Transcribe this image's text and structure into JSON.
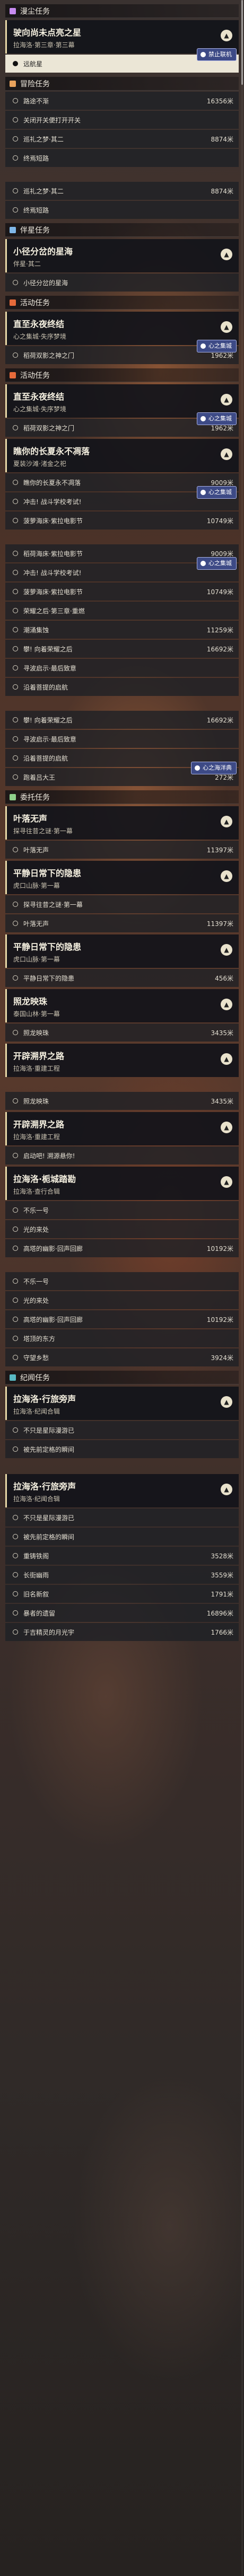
{
  "colors": {
    "spiral": "#c68bf0",
    "legend": "#e8a25c",
    "companion": "#7fb7e8",
    "event": "#e56a3a",
    "area": "#8ed08b",
    "leisure": "#58b9c4"
  },
  "items": [
    {
      "kind": "cat",
      "label": "漫尘任务",
      "color": "spiral"
    },
    {
      "kind": "card",
      "title": "驶向尚未点亮之星",
      "subtitle": "拉海洛·第三章·第三幕"
    },
    {
      "kind": "btn",
      "label": "远航星",
      "badge": "禁止联机"
    },
    {
      "kind": "cat",
      "label": "冒险任务",
      "color": "legend"
    },
    {
      "kind": "row",
      "label": "路途不渐",
      "value": "16356米"
    },
    {
      "kind": "row",
      "label": "关闭开关便打开开关",
      "value": ""
    },
    {
      "kind": "row",
      "label": "巡礼之梦·其二",
      "value": "8874米"
    },
    {
      "kind": "row",
      "label": "终焉短路",
      "value": ""
    },
    {
      "kind": "gap"
    },
    {
      "kind": "row",
      "label": "巡礼之梦·其二",
      "value": "8874米"
    },
    {
      "kind": "row",
      "label": "终焉短路",
      "value": ""
    },
    {
      "kind": "cat",
      "label": "伴星任务",
      "color": "companion"
    },
    {
      "kind": "card",
      "title": "小径分岔的星海",
      "subtitle": "伴星·其二"
    },
    {
      "kind": "row",
      "label": "小径分岔的星海",
      "value": ""
    },
    {
      "kind": "cat",
      "label": "活动任务",
      "color": "event"
    },
    {
      "kind": "card",
      "title": "直至永夜终结",
      "subtitle": "心之集城·失序梦境"
    },
    {
      "kind": "row",
      "label": "稻荷双影之神之门",
      "value": "1962米",
      "badge": "心之集城"
    },
    {
      "kind": "cat",
      "label": "活动任务",
      "color": "event"
    },
    {
      "kind": "card",
      "title": "直至永夜终结",
      "subtitle": "心之集城·失序梦境"
    },
    {
      "kind": "row",
      "label": "稻荷双影之神之门",
      "value": "1962米",
      "badge": "心之集城"
    },
    {
      "kind": "card",
      "title": "瞧你的长夏永不凋落",
      "subtitle": "夏装沙滩·渚金之祀"
    },
    {
      "kind": "row",
      "label": "瞧你的长夏永不凋落",
      "value": "9009米"
    },
    {
      "kind": "row",
      "label": "冲击! 战斗学校考试!",
      "value": "",
      "badge": "心之集城"
    },
    {
      "kind": "row",
      "label": "菠萝海床·紫拉电影节",
      "value": "10749米"
    },
    {
      "kind": "gap"
    },
    {
      "kind": "row",
      "label": "稻荷海床·紫拉电影节",
      "value": "9009米"
    },
    {
      "kind": "row",
      "label": "冲击! 战斗学校考试!",
      "value": "",
      "badge": "心之集城"
    },
    {
      "kind": "row",
      "label": "菠萝海床·紫拉电影节",
      "value": "10749米"
    },
    {
      "kind": "row",
      "label": "荣耀之后·第三章·重燃",
      "value": ""
    },
    {
      "kind": "row",
      "label": "潮涌集蚀",
      "value": "11259米"
    },
    {
      "kind": "row",
      "label": "攀! 向着荣耀之后",
      "value": "16692米"
    },
    {
      "kind": "row",
      "label": "寻波启示·最后致意",
      "value": ""
    },
    {
      "kind": "row",
      "label": "沿着菩提的启航",
      "value": ""
    },
    {
      "kind": "gap"
    },
    {
      "kind": "row",
      "label": "攀! 向着荣耀之后",
      "value": "16692米"
    },
    {
      "kind": "row",
      "label": "寻波启示·最后致意",
      "value": ""
    },
    {
      "kind": "row",
      "label": "沿着菩提的启航",
      "value": ""
    },
    {
      "kind": "row",
      "label": "跑着吕大王",
      "value": "272米",
      "badge": "心之海洋典"
    },
    {
      "kind": "cat",
      "label": "委托任务",
      "color": "area"
    },
    {
      "kind": "card",
      "title": "叶落无声",
      "subtitle": "探寻往昔之谜·第一幕"
    },
    {
      "kind": "row",
      "label": "叶落无声",
      "value": "11397米"
    },
    {
      "kind": "card",
      "title": "平静日常下的隐患",
      "subtitle": "虎口山脉·第一幕"
    },
    {
      "kind": "row",
      "label": "探寻往昔之谜·第一幕",
      "value": ""
    },
    {
      "kind": "row",
      "label": "叶落无声",
      "value": "11397米"
    },
    {
      "kind": "card",
      "title": "平静日常下的隐患",
      "subtitle": "虎口山脉·第一幕"
    },
    {
      "kind": "row",
      "label": "平静日常下的隐患",
      "value": "456米"
    },
    {
      "kind": "card",
      "title": "照龙映珠",
      "subtitle": "泰国山林·第一幕"
    },
    {
      "kind": "row",
      "label": "照龙映珠",
      "value": "3435米"
    },
    {
      "kind": "card",
      "title": "开辟溯界之路",
      "subtitle": "拉海洛·重建工程"
    },
    {
      "kind": "gap"
    },
    {
      "kind": "row",
      "label": "照龙映珠",
      "value": "3435米"
    },
    {
      "kind": "card",
      "title": "开辟溯界之路",
      "subtitle": "拉海洛·重建工程"
    },
    {
      "kind": "row",
      "label": "启动吧! 溯源悬你!",
      "value": ""
    },
    {
      "kind": "card",
      "title": "拉海洛·栀城踏勘",
      "subtitle": "拉海洛·查行合辑"
    },
    {
      "kind": "row",
      "label": "不乐一号",
      "value": ""
    },
    {
      "kind": "row",
      "label": "光的来处",
      "value": ""
    },
    {
      "kind": "row",
      "label": "高塔的幽影·回声回廊",
      "value": "10192米"
    },
    {
      "kind": "gap"
    },
    {
      "kind": "row",
      "label": "不乐一号",
      "value": ""
    },
    {
      "kind": "row",
      "label": "光的来处",
      "value": ""
    },
    {
      "kind": "row",
      "label": "高塔的幽影·回声回廊",
      "value": "10192米"
    },
    {
      "kind": "row",
      "label": "塔顶的东方",
      "value": ""
    },
    {
      "kind": "row",
      "label": "守望乡愁",
      "value": "3924米"
    },
    {
      "kind": "cat",
      "label": "纪闻任务",
      "color": "leisure"
    },
    {
      "kind": "card",
      "title": "拉海洛·行旅旁声",
      "subtitle": "拉海洛·纪闻合辑"
    },
    {
      "kind": "row",
      "label": "不只是星际漫游已",
      "value": ""
    },
    {
      "kind": "row",
      "label": "被先前定格的瞬间",
      "value": ""
    },
    {
      "kind": "gap"
    },
    {
      "kind": "card",
      "title": "拉海洛·行旅旁声",
      "subtitle": "拉海洛·纪闻合辑"
    },
    {
      "kind": "row",
      "label": "不只是星际漫游已",
      "value": ""
    },
    {
      "kind": "row",
      "label": "被先前定格的瞬间",
      "value": ""
    },
    {
      "kind": "row",
      "label": "重铸铁阁",
      "value": "3528米"
    },
    {
      "kind": "row",
      "label": "长街幽雨",
      "value": "3559米"
    },
    {
      "kind": "row",
      "label": "旧名新叙",
      "value": "1791米"
    },
    {
      "kind": "row",
      "label": "暴者的遗留",
      "value": "16896米"
    },
    {
      "kind": "row",
      "label": "于吉精灵的月光宇",
      "value": "1766米"
    }
  ]
}
